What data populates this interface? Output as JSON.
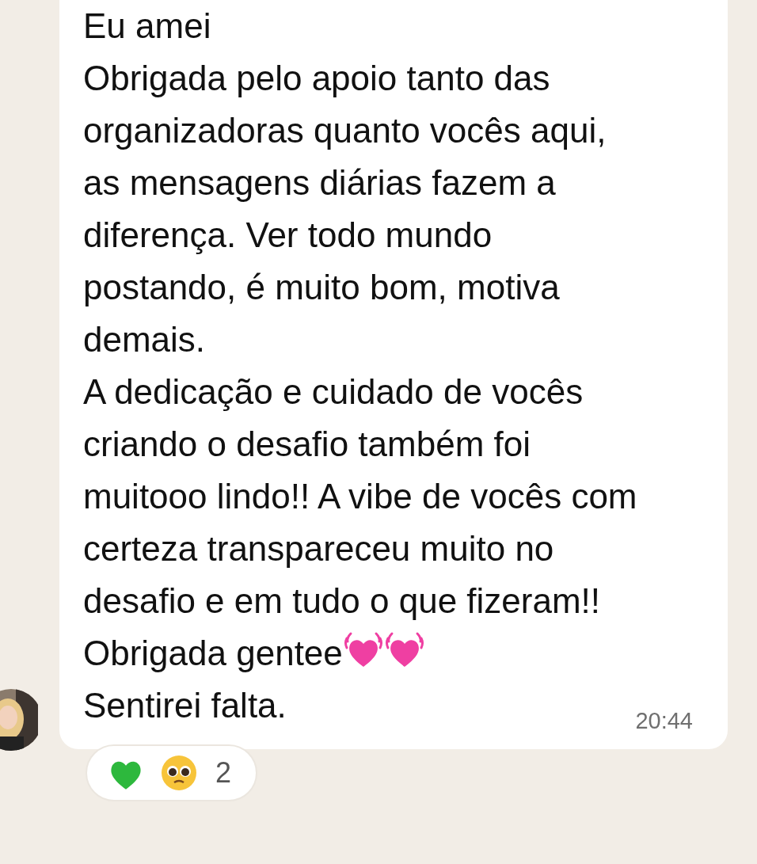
{
  "message": {
    "paragraphs": [
      {
        "text": "Eu amei"
      },
      {
        "text": "Obrigada pelo apoio tanto das organizadoras quanto vocês aqui, as mensagens diárias fazem a diferença. Ver todo mundo postando, é muito bom, motiva demais."
      },
      {
        "text": "A dedicação e cuidado de vocês criando o desafio também foi muitooo lindo!! A vibe de vocês com certeza transpareceu muito no desafio e em tudo o que fizeram!!"
      },
      {
        "text": "Obrigada gentee",
        "icons": [
          {
            "kind": "heart"
          },
          {
            "kind": "heart"
          }
        ]
      },
      {
        "text": "Sentirei falta."
      }
    ],
    "time": "20:44",
    "reactions": [
      {
        "kind": "heart"
      },
      {
        "kind": "pleading-face"
      }
    ],
    "reaction_count": "2"
  }
}
